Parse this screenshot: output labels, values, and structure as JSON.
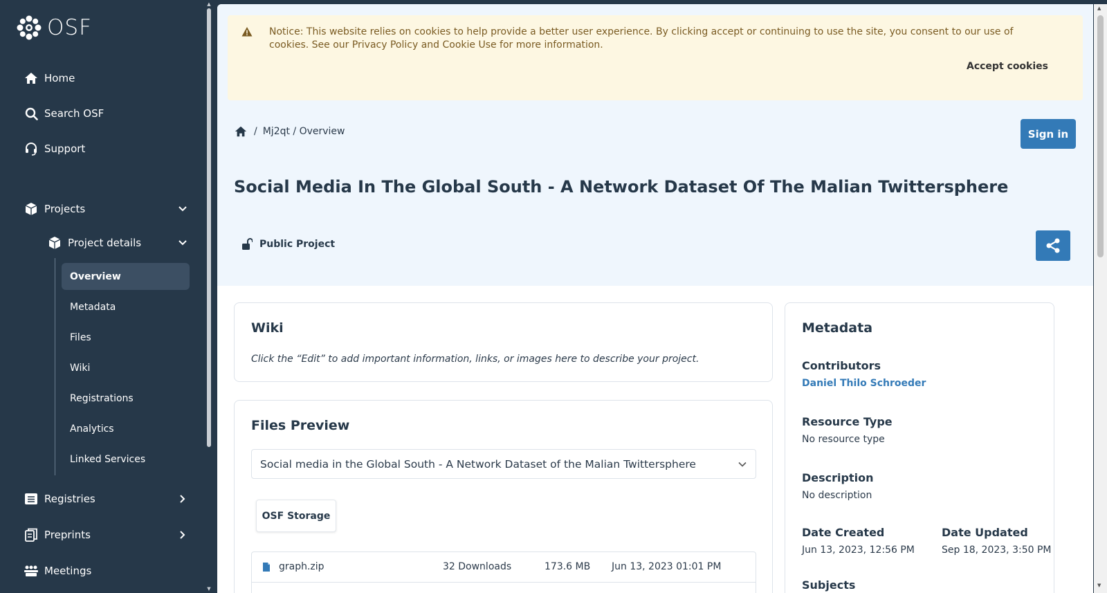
{
  "logo": {
    "text": "OSF"
  },
  "nav": {
    "home": "Home",
    "search": "Search OSF",
    "support": "Support",
    "projects": "Projects",
    "project_details": "Project details",
    "sub_items": [
      "Overview",
      "Metadata",
      "Files",
      "Wiki",
      "Registrations",
      "Analytics",
      "Linked Services"
    ],
    "registries": "Registries",
    "preprints": "Preprints",
    "meetings": "Meetings"
  },
  "cookie": {
    "text": "Notice: This website relies on cookies to help provide a better user experience. By clicking accept or continuing to use the site, you consent to our use of cookies. See our Privacy Policy and Cookie Use for more information.",
    "accept": "Accept cookies"
  },
  "breadcrumb": {
    "sep": "/",
    "path": "Mj2qt / Overview"
  },
  "header": {
    "sign_in": "Sign in",
    "title": "Social Media In The Global South - A Network Dataset Of The Malian Twittersphere",
    "visibility": "Public Project"
  },
  "wiki": {
    "title": "Wiki",
    "body": "Click the “Edit” to add important information, links, or images here to describe your project."
  },
  "files_preview": {
    "title": "Files Preview",
    "selected": "Social media in the Global South - A Network Dataset of the Malian Twittersphere",
    "storage": "OSF Storage",
    "files": [
      {
        "name": "graph.zip",
        "downloads": "32 Downloads",
        "size": "173.6 MB",
        "date": "Jun 13, 2023 01:01 PM"
      }
    ]
  },
  "metadata": {
    "title": "Metadata",
    "contributors_label": "Contributors",
    "contributor": "Daniel Thilo Schroeder",
    "resource_type_label": "Resource Type",
    "resource_type": "No resource type",
    "description_label": "Description",
    "description": "No description",
    "date_created_label": "Date Created",
    "date_created": "Jun 13, 2023, 12:56 PM",
    "date_updated_label": "Date Updated",
    "date_updated": "Sep 18, 2023, 3:50 PM",
    "subjects_label": "Subjects"
  },
  "colors": {
    "sidebar": "#263849",
    "accent": "#337ab7",
    "hero": "#eff6fd",
    "notice": "#fdf7e2"
  }
}
